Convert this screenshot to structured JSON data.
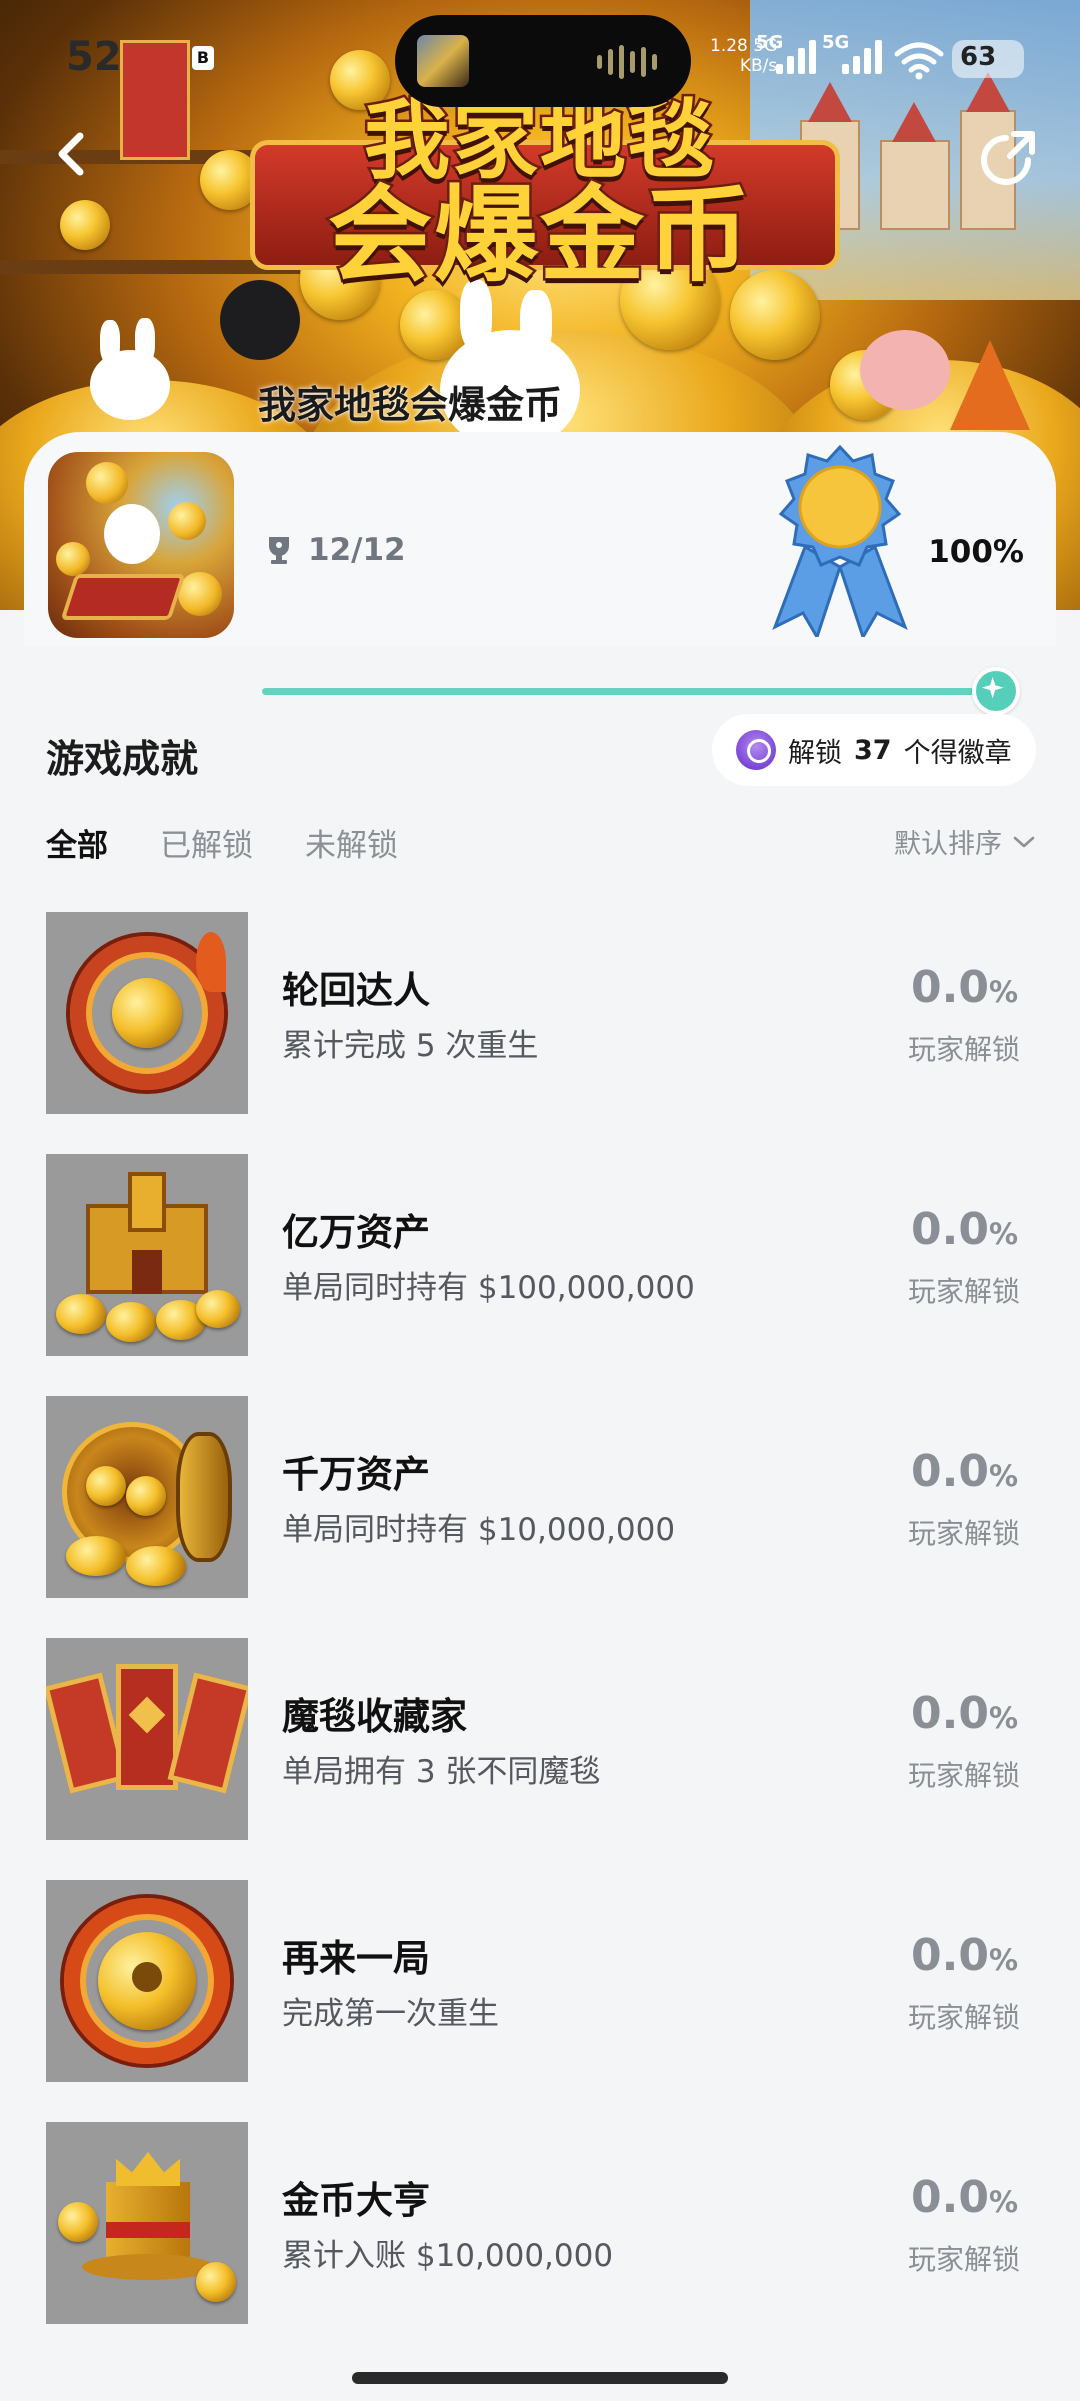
{
  "status_bar": {
    "time": "52",
    "notif_badge": "B",
    "net_speed_top": "1.28 5G",
    "net_speed_bottom": "KB/s",
    "sig1_label": "5G",
    "sig2_label": "5G",
    "battery": "63"
  },
  "banner": {
    "logo_line1": "我家地毯",
    "logo_line2": "会爆金币"
  },
  "game": {
    "name": "我家地毯会爆金币",
    "trophy_count": "12/12",
    "progress_percent": "100%",
    "progress_value": 1.0
  },
  "section": {
    "title": "游戏成就",
    "badge_prefix": "解锁",
    "badge_count": "37",
    "badge_suffix": "个得徽章"
  },
  "tabs": [
    {
      "label": "全部",
      "active": true
    },
    {
      "label": "已解锁",
      "active": false
    },
    {
      "label": "未解锁",
      "active": false
    }
  ],
  "sort_label": "默认排序",
  "achievements": [
    {
      "name": "轮回达人",
      "desc": "累计完成 5 次重生",
      "rate": "0.0",
      "rate_unit": "%",
      "rate_label": "玩家解锁",
      "icon": "phoenix-coin-icon"
    },
    {
      "name": "亿万资产",
      "desc": "单局同时持有 $100,000,000",
      "rate": "0.0",
      "rate_unit": "%",
      "rate_label": "玩家解锁",
      "icon": "gold-castle-icon"
    },
    {
      "name": "千万资产",
      "desc": "单局同时持有 $10,000,000",
      "rate": "0.0",
      "rate_unit": "%",
      "rate_label": "玩家解锁",
      "icon": "vault-coins-icon"
    },
    {
      "name": "魔毯收藏家",
      "desc": "单局拥有 3 张不同魔毯",
      "rate": "0.0",
      "rate_unit": "%",
      "rate_label": "玩家解锁",
      "icon": "carpets-icon"
    },
    {
      "name": "再来一局",
      "desc": "完成第一次重生",
      "rate": "0.0",
      "rate_unit": "%",
      "rate_label": "玩家解锁",
      "icon": "clover-coin-icon"
    },
    {
      "name": "金币大亨",
      "desc": "累计入账 $10,000,000",
      "rate": "0.0",
      "rate_unit": "%",
      "rate_label": "玩家解锁",
      "icon": "crown-hat-icon"
    }
  ],
  "colors": {
    "accent": "#55cfb9",
    "background": "#f4f5f7",
    "muted": "#8a8f96",
    "medal_blue": "#5b9ee6",
    "medal_gold": "#f7c53c"
  }
}
